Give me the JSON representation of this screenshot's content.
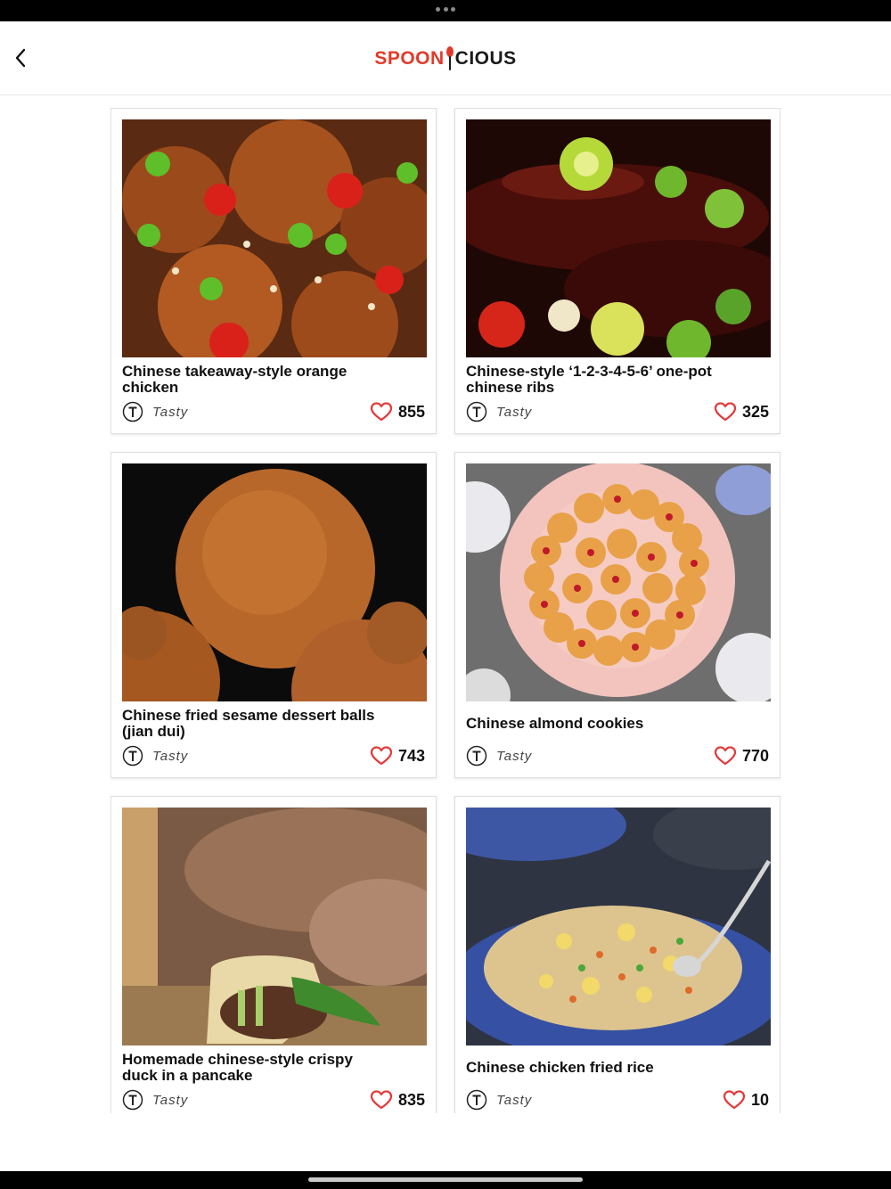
{
  "header": {
    "logo_part1": "SPOON",
    "logo_part2": "CIOUS",
    "back_icon": "chevron-left-icon",
    "brand_color": "#e23a2a"
  },
  "recipes": [
    {
      "title": "Chinese takeaway-style orange chicken",
      "source": "Tasty",
      "likes": "855"
    },
    {
      "title": "Chinese-style ‘1-2-3-4-5-6’ one-pot chinese ribs",
      "source": "Tasty",
      "likes": "325"
    },
    {
      "title": "Chinese fried sesame dessert balls (jian dui)",
      "source": "Tasty",
      "likes": "743"
    },
    {
      "title": "Chinese almond cookies",
      "source": "Tasty",
      "likes": "770"
    },
    {
      "title": "Homemade chinese-style crispy duck in a pancake",
      "source": "Tasty",
      "likes": "835"
    },
    {
      "title": "Chinese chicken fried rice",
      "source": "Tasty",
      "likes": "10"
    }
  ],
  "icons": {
    "like": "heart-icon",
    "source": "tasty-logo-icon"
  },
  "colors": {
    "heart": "#e23a3a"
  }
}
